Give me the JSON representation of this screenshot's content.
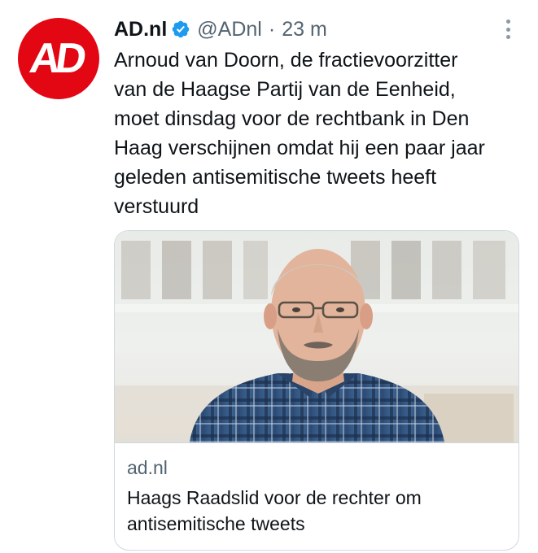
{
  "tweet": {
    "author": {
      "display_name": "AD.nl",
      "handle": "@ADnl",
      "avatar_text": "AD",
      "verified": true
    },
    "separator": "·",
    "time": "23 m",
    "text": "Arnoud van Doorn, de fractievoorzitter\nvan de Haagse Partij van de Eenheid,\nmoet dinsdag voor de rechtbank in Den\nHaag verschijnen omdat hij een paar jaar\ngeleden antisemitische tweets heeft\nverstuurd",
    "card": {
      "domain": "ad.nl",
      "title": "Haags Raadslid voor de rechter om antisemitische tweets"
    }
  },
  "colors": {
    "brand_red": "#e30613",
    "verified_blue": "#1d9bf0",
    "secondary_text": "#536471",
    "primary_text": "#0f1419",
    "border": "#cfd9de"
  },
  "icons": {
    "verified": "verified-badge-icon",
    "more": "more-options-icon"
  }
}
